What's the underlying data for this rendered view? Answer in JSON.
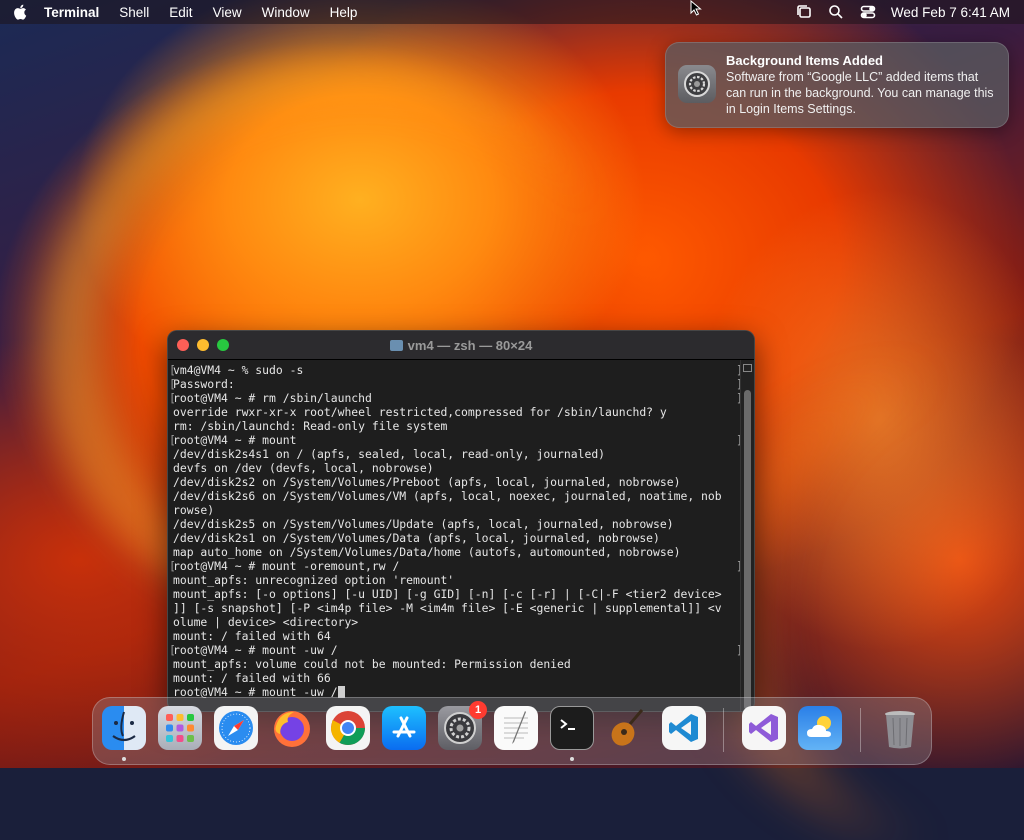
{
  "menubar": {
    "app_name": "Terminal",
    "items": [
      "Shell",
      "Edit",
      "View",
      "Window",
      "Help"
    ],
    "clock": "Wed Feb 7  6:41 AM"
  },
  "notification": {
    "title": "Background Items Added",
    "body": "Software from “Google LLC” added items that can run in the background. You can manage this in Login Items Settings."
  },
  "terminal": {
    "window_title": "vm4 — zsh — 80×24",
    "lines": [
      "vm4@VM4 ~ % sudo -s",
      "Password:",
      "root@VM4 ~ # rm /sbin/launchd",
      "override rwxr-xr-x root/wheel restricted,compressed for /sbin/launchd? y",
      "rm: /sbin/launchd: Read-only file system",
      "root@VM4 ~ # mount",
      "/dev/disk2s4s1 on / (apfs, sealed, local, read-only, journaled)",
      "devfs on /dev (devfs, local, nobrowse)",
      "/dev/disk2s2 on /System/Volumes/Preboot (apfs, local, journaled, nobrowse)",
      "/dev/disk2s6 on /System/Volumes/VM (apfs, local, noexec, journaled, noatime, nob",
      "rowse)",
      "/dev/disk2s5 on /System/Volumes/Update (apfs, local, journaled, nobrowse)",
      "/dev/disk2s1 on /System/Volumes/Data (apfs, local, journaled, nobrowse)",
      "map auto_home on /System/Volumes/Data/home (autofs, automounted, nobrowse)",
      "root@VM4 ~ # mount -oremount,rw /",
      "mount_apfs: unrecognized option 'remount'",
      "mount_apfs: [-o options] [-u UID] [-g GID] [-n] [-c [-r] | [-C|-F <tier2 device>",
      "]] [-s snapshot] [-P <im4p file> -M <im4m file> [-E <generic | supplemental]] <v",
      "olume | device> <directory>",
      "mount: / failed with 64",
      "root@VM4 ~ # mount -uw /",
      "mount_apfs: volume could not be mounted: Permission denied",
      "mount: / failed with 66",
      "root@VM4 ~ # mount -uw /"
    ]
  },
  "dock": {
    "apps": [
      {
        "name": "Finder",
        "icon": "finder-icon"
      },
      {
        "name": "Launchpad",
        "icon": "launchpad-icon"
      },
      {
        "name": "Safari",
        "icon": "safari-icon"
      },
      {
        "name": "Firefox",
        "icon": "firefox-icon"
      },
      {
        "name": "Google Chrome",
        "icon": "chrome-icon"
      },
      {
        "name": "App Store",
        "icon": "app-store-icon"
      },
      {
        "name": "System Settings",
        "icon": "system-settings-icon",
        "badge": "1"
      },
      {
        "name": "TextEdit",
        "icon": "textedit-icon"
      },
      {
        "name": "Terminal",
        "icon": "terminal-icon"
      },
      {
        "name": "GarageBand",
        "icon": "guitar-icon"
      },
      {
        "name": "Visual Studio Code",
        "icon": "vscode-icon"
      },
      {
        "name": "Visual Studio",
        "icon": "visual-studio-icon"
      },
      {
        "name": "Weather",
        "icon": "weather-icon"
      },
      {
        "name": "Trash",
        "icon": "trash-icon"
      }
    ]
  },
  "colors": {
    "close": "#fe5f57",
    "minimize": "#febc2e",
    "maximize": "#28c840",
    "terminal_bg": "#1e1e1e",
    "badge": "#ff3b30"
  }
}
